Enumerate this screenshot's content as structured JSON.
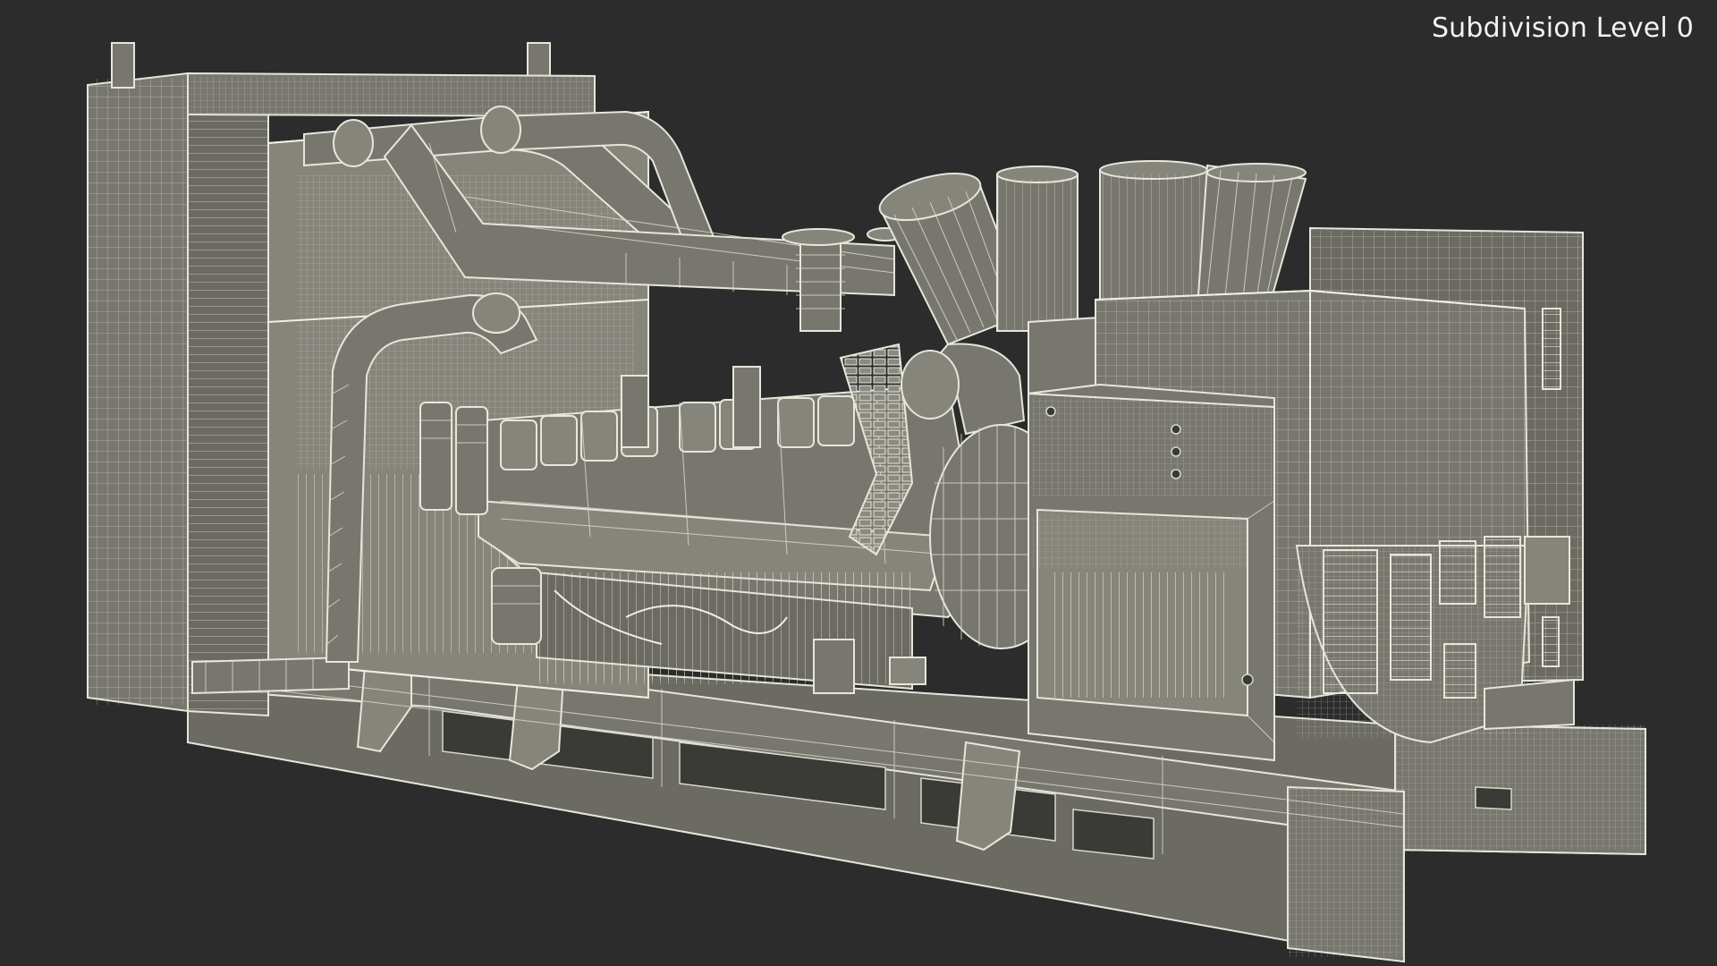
{
  "viewport": {
    "subdivision_label": "Subdivision Level 0"
  },
  "colors": {
    "background": "#2c2c2c",
    "mesh_fill": "#77776f",
    "wire": "#e6e6da"
  }
}
